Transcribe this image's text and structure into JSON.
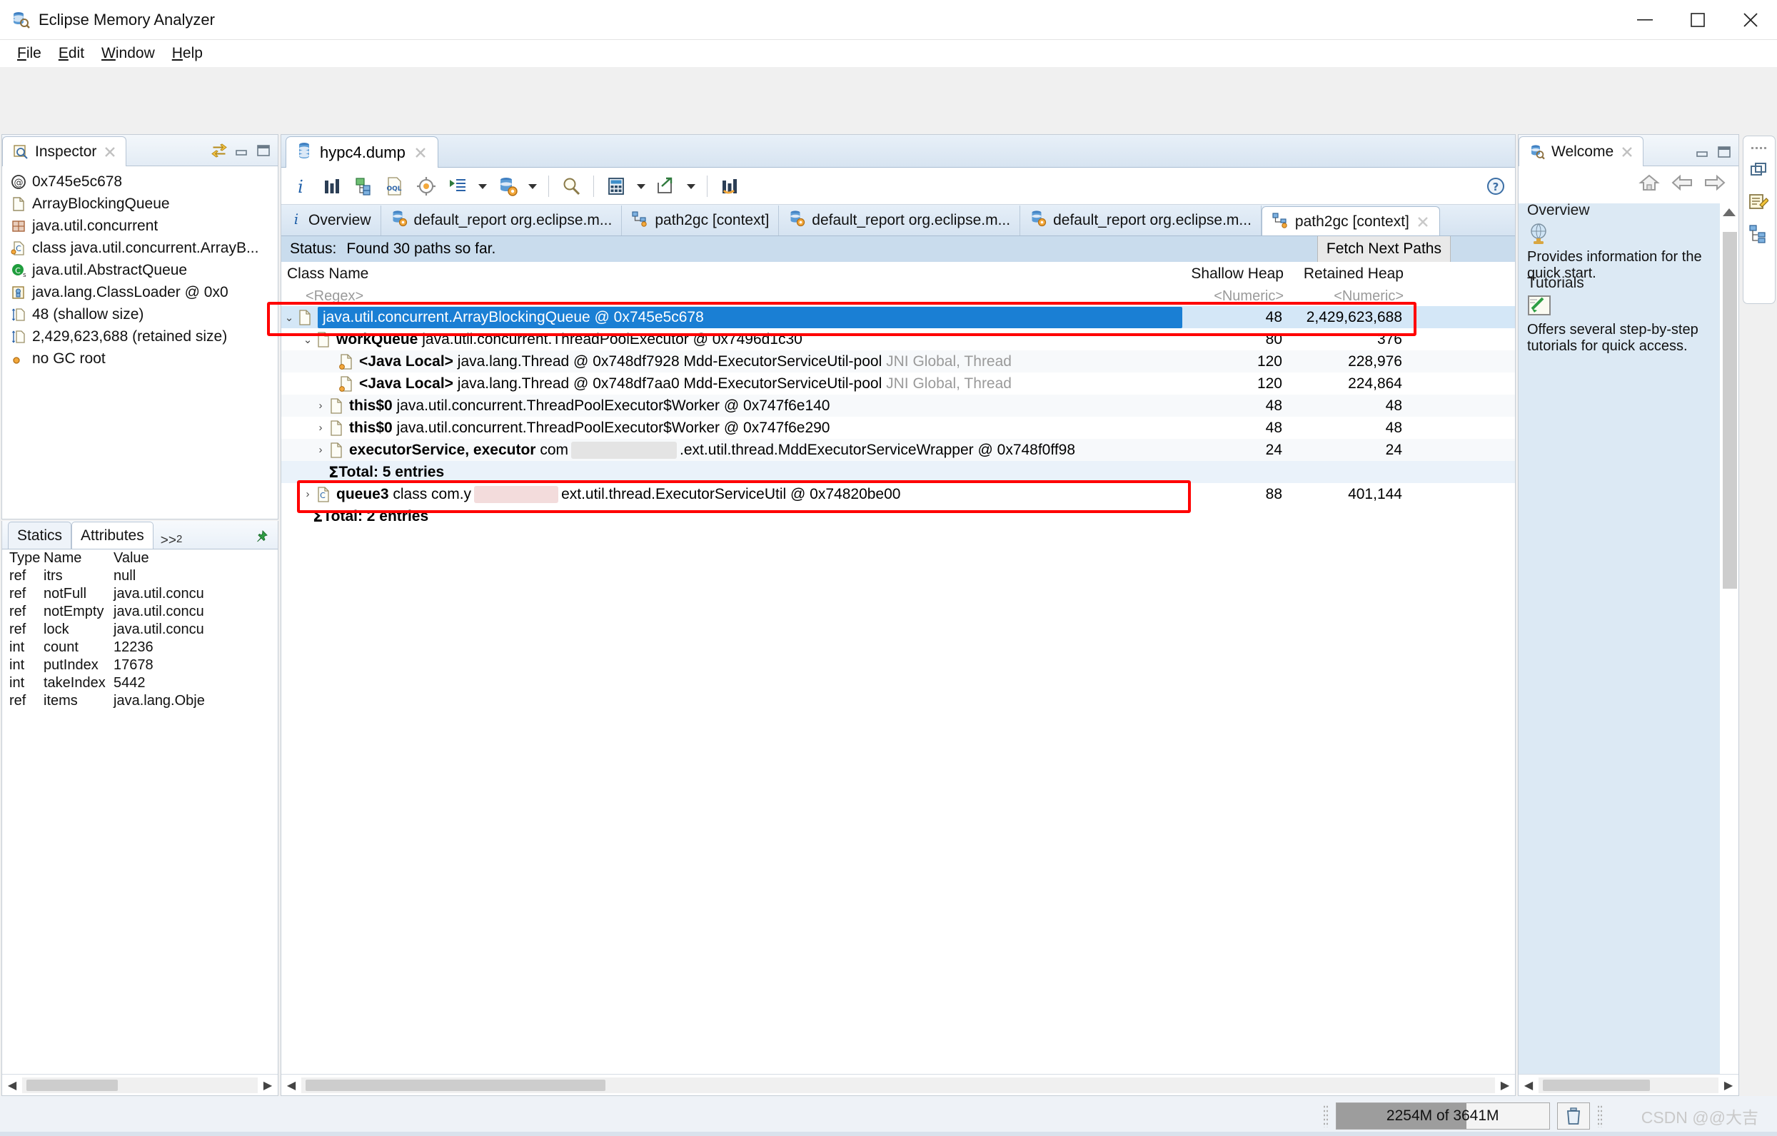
{
  "window": {
    "title": "Eclipse Memory Analyzer",
    "app_icon": "memory-analyzer-icon",
    "minimize": "minimize",
    "maximize": "maximize",
    "close": "close"
  },
  "menubar": {
    "items": [
      {
        "label": "File",
        "mnemonic": "F"
      },
      {
        "label": "Edit",
        "mnemonic": "E"
      },
      {
        "label": "Window",
        "mnemonic": "W"
      },
      {
        "label": "Help",
        "mnemonic": "H"
      }
    ]
  },
  "inspector": {
    "tab_label": "Inspector",
    "tab_icon": "inspector-icon",
    "view_tools": [
      "link-with-editor-icon",
      "minimize-icon",
      "maximize-icon"
    ],
    "rows": [
      {
        "icon": "at-icon",
        "text": "0x745e5c678"
      },
      {
        "icon": "object-icon",
        "text": "ArrayBlockingQueue"
      },
      {
        "icon": "package-icon",
        "text": "java.util.concurrent"
      },
      {
        "icon": "class-icon",
        "text": "class java.util.concurrent.ArrayB..."
      },
      {
        "icon": "superclass-icon",
        "text": "java.util.AbstractQueue"
      },
      {
        "icon": "classloader-icon",
        "text": "java.lang.ClassLoader @ 0x0"
      },
      {
        "icon": "shallow-size-icon",
        "text": "48 (shallow size)"
      },
      {
        "icon": "retained-size-icon",
        "text": "2,429,623,688 (retained size)"
      },
      {
        "icon": "gcroot-icon",
        "text": "no GC root"
      }
    ]
  },
  "attributes": {
    "tabs": [
      {
        "label": "Statics",
        "active": false
      },
      {
        "label": "Attributes",
        "active": true
      }
    ],
    "overflow": ">>",
    "overflow_count": "2",
    "pin_icon": "pin-icon",
    "headers": [
      "Type",
      "Name",
      "Value"
    ],
    "rows": [
      {
        "type": "ref",
        "name": "itrs",
        "value": "null"
      },
      {
        "type": "ref",
        "name": "notFull",
        "value": "java.util.concu"
      },
      {
        "type": "ref",
        "name": "notEmpty",
        "value": "java.util.concu"
      },
      {
        "type": "ref",
        "name": "lock",
        "value": "java.util.concu"
      },
      {
        "type": "int",
        "name": "count",
        "value": "12236"
      },
      {
        "type": "int",
        "name": "putIndex",
        "value": "17678"
      },
      {
        "type": "int",
        "name": "takeIndex",
        "value": "5442"
      },
      {
        "type": "ref",
        "name": "items",
        "value": "java.lang.Obje"
      }
    ]
  },
  "editor": {
    "tab_label": "hypc4.dump",
    "tab_icon": "heapdump-icon",
    "toolbar": [
      {
        "icon": "info-icon",
        "name": "overview-info"
      },
      {
        "icon": "histogram-icon",
        "name": "histogram"
      },
      {
        "icon": "dominator-tree-icon",
        "name": "dominator-tree"
      },
      {
        "icon": "oql-icon",
        "name": "oql"
      },
      {
        "icon": "query-browser-icon",
        "name": "query-browser"
      },
      {
        "icon": "run-expert-icon",
        "name": "run-expert-system-test",
        "caret": true
      },
      {
        "icon": "heapdump-settings-icon",
        "name": "open-heap-dump",
        "caret": true
      },
      {
        "icon": "search-icon",
        "name": "find"
      },
      {
        "icon": "calculator-icon",
        "name": "calculate-precise-retained-size",
        "caret": true
      },
      {
        "icon": "export-icon",
        "name": "export",
        "caret": true
      },
      {
        "icon": "compare-icon",
        "name": "compare-baseline"
      }
    ],
    "help_icon": "help-icon",
    "inner_tabs": [
      {
        "label": "Overview",
        "icon": "info-icon",
        "active": false,
        "closable": false
      },
      {
        "label": "default_report  org.eclipse.m...",
        "icon": "report-icon",
        "active": false,
        "closable": false
      },
      {
        "label": "path2gc  [context]",
        "icon": "path2gc-icon",
        "active": false,
        "closable": false
      },
      {
        "label": "default_report  org.eclipse.m...",
        "icon": "report-icon",
        "active": false,
        "closable": false
      },
      {
        "label": "default_report  org.eclipse.m...",
        "icon": "report-icon",
        "active": false,
        "closable": false
      },
      {
        "label": "path2gc  [context]",
        "icon": "path2gc-icon",
        "active": true,
        "closable": true
      }
    ],
    "status": {
      "label": "Status:",
      "text": "Found 30 paths so far."
    },
    "fetch_button": "Fetch Next Paths",
    "table": {
      "headers": {
        "class_name": "Class Name",
        "shallow": "Shallow Heap",
        "retained": "Retained Heap"
      },
      "filters": {
        "class_name": "<Regex>",
        "shallow": "<Numeric>",
        "retained": "<Numeric>"
      },
      "rows": [
        {
          "kind": "node",
          "indent": 0,
          "twisty": "expanded",
          "icon": "object-icon",
          "selected": true,
          "label": "java.util.concurrent.ArrayBlockingQueue @ 0x745e5c678",
          "shallow": "48",
          "retained": "2,429,623,688"
        },
        {
          "kind": "node",
          "indent": 1,
          "twisty": "expanded",
          "icon": "object-icon",
          "bold_prefix": "workQueue",
          "label": "java.util.concurrent.ThreadPoolExecutor @ 0x7496d1c30",
          "shallow": "80",
          "retained": "376"
        },
        {
          "kind": "node",
          "indent": 2,
          "twisty": "none",
          "icon": "gcroot-object-icon",
          "bold_prefix": "<Java Local>",
          "label": "java.lang.Thread @ 0x748df7928  Mdd-ExecutorServiceUtil-pool",
          "suffix": "JNI Global, Thread",
          "shallow": "120",
          "retained": "228,976"
        },
        {
          "kind": "node",
          "indent": 2,
          "twisty": "none",
          "icon": "gcroot-object-icon",
          "bold_prefix": "<Java Local>",
          "label": "java.lang.Thread @ 0x748df7aa0  Mdd-ExecutorServiceUtil-pool",
          "suffix": "JNI Global, Thread",
          "shallow": "120",
          "retained": "224,864"
        },
        {
          "kind": "node",
          "indent": 2,
          "twisty": "collapsed",
          "icon": "object-icon",
          "bold_prefix": "this$0",
          "label": "java.util.concurrent.ThreadPoolExecutor$Worker @ 0x747f6e140",
          "shallow": "48",
          "retained": "48"
        },
        {
          "kind": "node",
          "indent": 2,
          "twisty": "collapsed",
          "icon": "object-icon",
          "bold_prefix": "this$0",
          "label": "java.util.concurrent.ThreadPoolExecutor$Worker @ 0x747f6e290",
          "shallow": "48",
          "retained": "48"
        },
        {
          "kind": "node",
          "indent": 2,
          "twisty": "collapsed",
          "icon": "object-icon",
          "bold_prefix": "executorService, executor",
          "label_pre": "com",
          "masked": true,
          "label_post": ".ext.util.thread.MddExecutorServiceWrapper @ 0x748f0ff98",
          "shallow": "24",
          "retained": "24"
        },
        {
          "kind": "total",
          "indent": 2,
          "label": "Total: 5 entries",
          "shallow": "",
          "retained": ""
        },
        {
          "kind": "node",
          "indent": 1,
          "twisty": "collapsed",
          "icon": "class-icon",
          "bold_prefix": "queue3",
          "label_pre": "class com.y",
          "masked": true,
          "label_post": "ext.util.thread.ExecutorServiceUtil @ 0x74820be00",
          "shallow": "88",
          "retained": "401,144"
        },
        {
          "kind": "total",
          "indent": 1,
          "label": "Total: 2 entries",
          "shallow": "",
          "retained": ""
        }
      ]
    }
  },
  "welcome": {
    "tab_label": "Welcome",
    "tab_icon": "memory-analyzer-icon",
    "view_tools": [
      "minimize-icon",
      "maximize-icon"
    ],
    "nav": [
      "home-icon",
      "back-icon",
      "forward-icon"
    ],
    "sections": [
      {
        "heading": "Overview",
        "icon": "globe-icon",
        "text": "Provides information for the quick start."
      },
      {
        "heading": "Tutorials",
        "icon": "tutorials-icon",
        "text": "Offers several step-by-step tutorials for quick access."
      }
    ]
  },
  "fast_view_bar": {
    "items": [
      "restore-icon",
      "notes-icon",
      "dominator-tree-icon"
    ]
  },
  "statusbar": {
    "memory_text": "2254M of 3641M",
    "memory_used_percent": 61,
    "trash_icon": "trash-icon",
    "watermark": "CSDN @@大吉"
  },
  "colors": {
    "selection_blue": "#1a7fd4",
    "annotation_red": "#ff0000",
    "status_band": "#c9dced",
    "welcome_card": "#dce9f4"
  }
}
